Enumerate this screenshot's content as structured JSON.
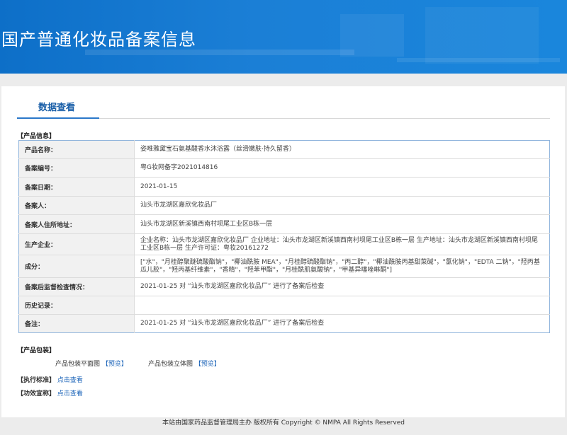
{
  "header": {
    "title": "国产普通化妆品备案信息"
  },
  "tab": {
    "label": "数据查看"
  },
  "product_section": {
    "title": "【产品信息】"
  },
  "rows": [
    {
      "label": "产品名称：",
      "value": "姿唯雅黛宝石氨基酸香水沐浴露（丝滑嫩肤·持久留香）"
    },
    {
      "label": "备案编号：",
      "value": "粤G妆网备字2021014816"
    },
    {
      "label": "备案日期：",
      "value": "2021-01-15"
    },
    {
      "label": "备案人：",
      "value": "汕头市龙湖区嘉欣化妆品厂"
    },
    {
      "label": "备案人住所地址：",
      "value": "汕头市龙湖区新溪镇西南村坝尾工业区B栋一层"
    },
    {
      "label": "生产企业：",
      "value": "企业名称：汕头市龙湖区嘉欣化妆品厂 企业地址：汕头市龙湖区新溪镇西南村坝尾工业区B栋一层 生产地址：汕头市龙湖区新溪镇西南村坝尾工业区B栋一层 生产许可证：粤妆20161272"
    },
    {
      "label": "成分：",
      "value": "[\"水\"，\"月桂醇聚醚硫酸酯钠\"，\"椰油酰胺 MEA\"，\"月桂醇硫酸酯钠\"，\"丙二醇\"，\"椰油酰胺丙基甜菜碱\"，\"氯化钠\"，\"EDTA 二钠\"，\"羟丙基瓜儿胶\"，\"羟丙基纤维素\"，\"香精\"，\"羟苯甲酯\"，\"月桂酰肌氨酸钠\"，\"甲基异噻唑啉酮\"]"
    },
    {
      "label": "备案后监督检查情况：",
      "value": "2021-01-25 对 “汕头市龙湖区嘉欣化妆品厂” 进行了备案后检查"
    },
    {
      "label": "历史记录：",
      "value": ""
    },
    {
      "label": "备注：",
      "value": "2021-01-25 对 “汕头市龙湖区嘉欣化妆品厂” 进行了备案后检查"
    }
  ],
  "package_section": {
    "title": "【产品包装】",
    "flat_label": "产品包装平面图",
    "flat_link": "【预览】",
    "solid_label": "产品包装立体图",
    "solid_link": "【预览】"
  },
  "standard": {
    "title": "【执行标准】",
    "link": "点击查看"
  },
  "efficacy": {
    "title": "【功效宣称】",
    "link": "点击查看"
  },
  "footer": {
    "text": "本站由国家药品监督管理局主办 版权所有 Copyright © NMPA All Rights Reserved"
  }
}
